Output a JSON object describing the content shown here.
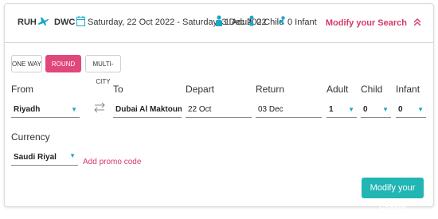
{
  "summary": {
    "origin": "RUH",
    "destination": "DWC",
    "dates": "Saturday, 22 Oct 2022 - Saturday, 3 Dec 2022",
    "adults": "1 Adult",
    "children": "0 Child",
    "infants": "0 Infant",
    "modify_link": "Modify your Search"
  },
  "trip_types": {
    "one_way": "ONE WAY",
    "round_trip": "ROUND TRIP",
    "multi_city": "MULTI-CITY",
    "selected": "round_trip"
  },
  "form": {
    "from_label": "From",
    "from_value": "Riyadh",
    "to_label": "To",
    "to_value": "Dubai Al Maktoum Interna",
    "depart_label": "Depart",
    "depart_value": "22 Oct",
    "return_label": "Return",
    "return_value": "03 Dec",
    "adult_label": "Adult",
    "adult_value": "1",
    "child_label": "Child",
    "child_value": "0",
    "infant_label": "Infant",
    "infant_value": "0",
    "currency_label": "Currency",
    "currency_value": "Saudi Riyal",
    "promo_link": "Add promo code",
    "submit_label": "Modify your Search"
  },
  "colors": {
    "accent_pink": "#e0487a",
    "link_pink": "#d63867",
    "teal": "#21b5b3",
    "icon_teal": "#1aa6c9"
  }
}
